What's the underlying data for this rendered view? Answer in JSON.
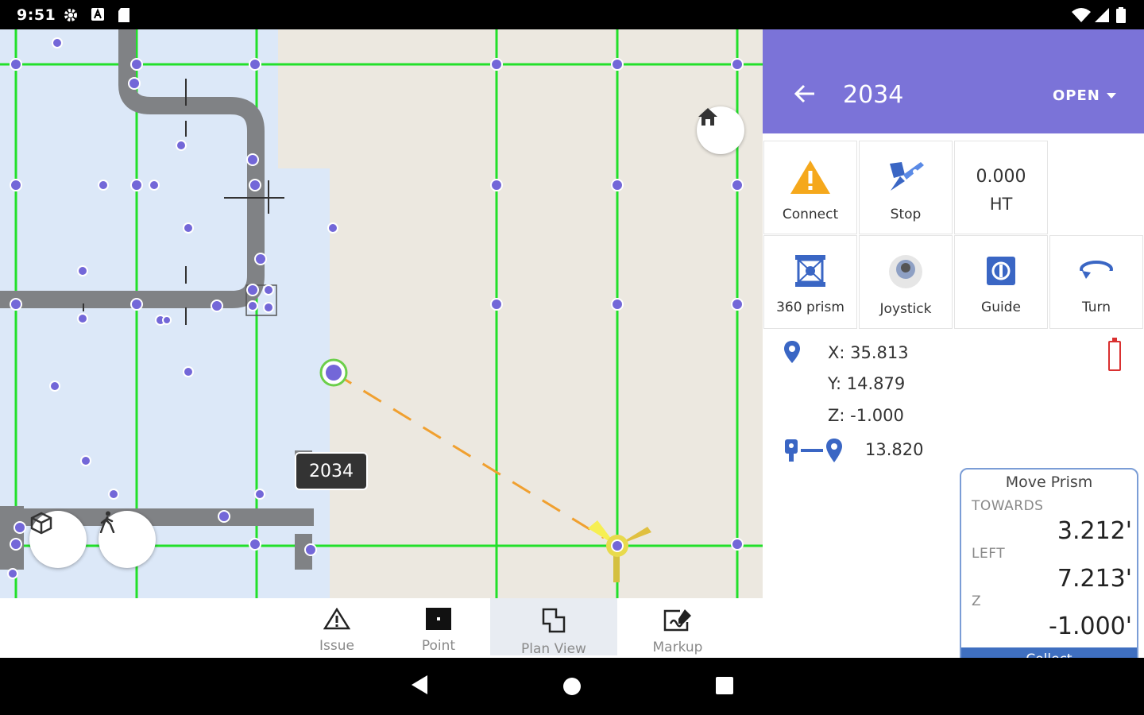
{
  "status_bar": {
    "time": "9:51",
    "icons": [
      "gear-icon",
      "notification-a-icon",
      "sd-card-icon",
      "wifi-icon",
      "signal-icon",
      "battery-icon"
    ]
  },
  "map": {
    "point_label": "2034",
    "buttons": [
      "home-icon",
      "3d-view-icon",
      "walk-icon"
    ],
    "colors": {
      "grid": "#22e02a",
      "points": "#7367d8",
      "pipe": "#808285",
      "building": "#dce8f8",
      "path": "#f0a030"
    }
  },
  "bottom_tabs": {
    "items": [
      {
        "label": "Issue",
        "icon": "warning-triangle-icon"
      },
      {
        "label": "Point",
        "icon": "point-square-icon"
      },
      {
        "label": "Plan View",
        "icon": "plan-view-icon",
        "active": true
      },
      {
        "label": "Markup",
        "icon": "markup-icon"
      }
    ]
  },
  "panel": {
    "header": {
      "title": "2034",
      "status": "OPEN",
      "back_icon": "arrow-left-icon",
      "color": "#7b73d8"
    },
    "tiles": [
      {
        "label": "Connect",
        "icon": "warning-icon"
      },
      {
        "label": "Stop",
        "icon": "stop-instrument-icon"
      },
      {
        "value": "0.000",
        "label": "HT"
      },
      {
        "label": "360 prism",
        "icon": "prism-360-icon"
      },
      {
        "label": "Joystick",
        "icon": "joystick-icon"
      },
      {
        "label": "Guide",
        "icon": "guide-icon"
      },
      {
        "label": "Turn",
        "icon": "turn-icon"
      }
    ],
    "coords": {
      "x": "X: 35.813",
      "y": "Y: 14.879",
      "z": "Z: -1.000"
    },
    "distance": "13.820",
    "move_prism": {
      "title": "Move Prism",
      "towards_label": "TOWARDS",
      "towards_value": "3.212'",
      "left_label": "LEFT",
      "left_value": "7.213'",
      "z_label": "Z",
      "z_value": "-1.000'",
      "collect_label": "Collect"
    }
  },
  "nav_bar": {
    "buttons": [
      "back-nav-icon",
      "home-nav-icon",
      "recents-nav-icon"
    ]
  }
}
